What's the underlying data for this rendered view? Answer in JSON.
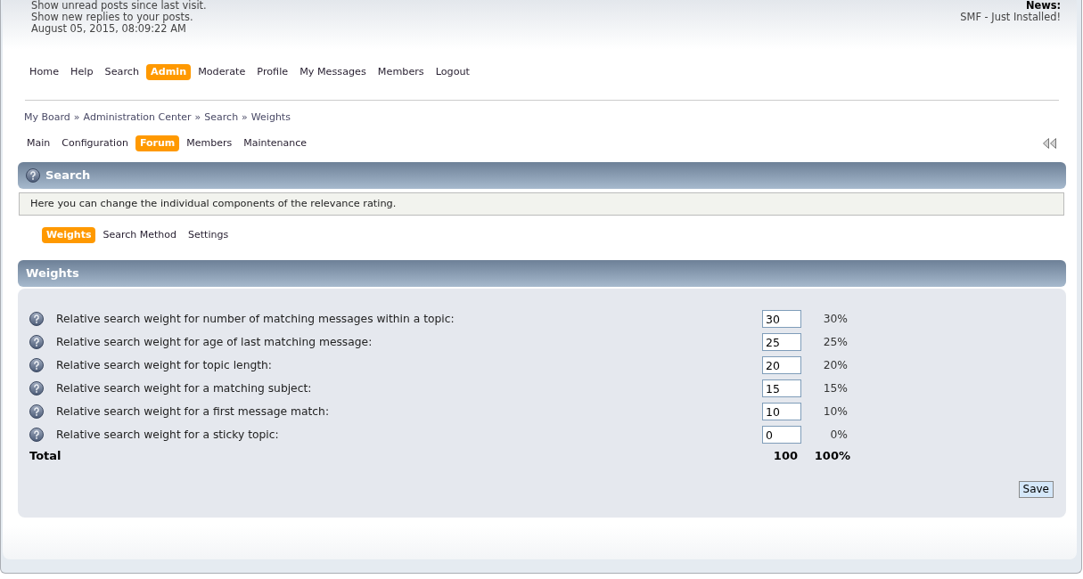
{
  "header": {
    "links": [
      "Show unread posts since last visit.",
      "Show new replies to your posts."
    ],
    "datetime": "August 05, 2015, 08:09:22 AM",
    "news_label": "News:",
    "news_text": "SMF - Just Installed!"
  },
  "main_menu": [
    {
      "label": "Home",
      "selected": false
    },
    {
      "label": "Help",
      "selected": false
    },
    {
      "label": "Search",
      "selected": false
    },
    {
      "label": "Admin",
      "selected": true
    },
    {
      "label": "Moderate",
      "selected": false
    },
    {
      "label": "Profile",
      "selected": false
    },
    {
      "label": "My Messages",
      "selected": false
    },
    {
      "label": "Members",
      "selected": false
    },
    {
      "label": "Logout",
      "selected": false
    }
  ],
  "breadcrumb": [
    {
      "label": "My Board"
    },
    {
      "separator": "»",
      "label": "Administration Center"
    },
    {
      "separator": "»",
      "label": "Search"
    },
    {
      "separator": "»",
      "label": "Weights"
    }
  ],
  "admin_tabs": [
    {
      "label": "Main",
      "selected": false
    },
    {
      "label": "Configuration",
      "selected": false
    },
    {
      "label": "Forum",
      "selected": true
    },
    {
      "label": "Members",
      "selected": false
    },
    {
      "label": "Maintenance",
      "selected": false
    }
  ],
  "search_section": {
    "title": "Search",
    "description": "Here you can change the individual components of the relevance rating."
  },
  "sub_tabs": [
    {
      "label": "Weights",
      "selected": true
    },
    {
      "label": "Search Method",
      "selected": false
    },
    {
      "label": "Settings",
      "selected": false
    }
  ],
  "weights": {
    "title": "Weights",
    "rows": [
      {
        "label": "Relative search weight for number of matching messages within a topic:",
        "value": "30",
        "percent": "30%"
      },
      {
        "label": "Relative search weight for age of last matching message:",
        "value": "25",
        "percent": "25%"
      },
      {
        "label": "Relative search weight for topic length:",
        "value": "20",
        "percent": "20%"
      },
      {
        "label": "Relative search weight for a matching subject:",
        "value": "15",
        "percent": "15%"
      },
      {
        "label": "Relative search weight for a first message match:",
        "value": "10",
        "percent": "10%"
      },
      {
        "label": "Relative search weight for a sticky topic:",
        "value": "0",
        "percent": "0%"
      }
    ],
    "total": {
      "label": "Total",
      "value": "100",
      "percent": "100%"
    },
    "save_button": "Save"
  }
}
